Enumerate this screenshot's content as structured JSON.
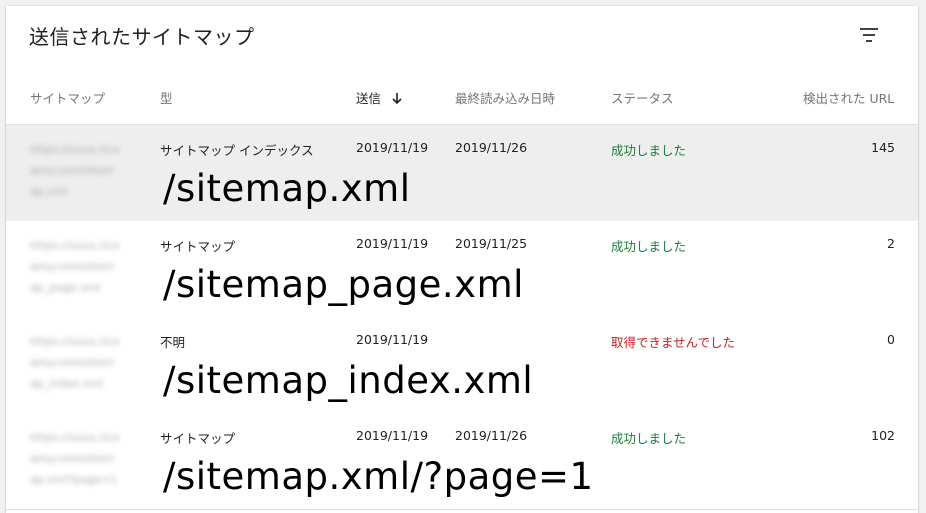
{
  "panel": {
    "title": "送信されたサイトマップ"
  },
  "columns": {
    "sitemap": "サイトマップ",
    "type": "型",
    "submitted": "送信",
    "last_read": "最終読み込み日時",
    "status": "ステータス",
    "discovered_urls": "検出された URL"
  },
  "rows": [
    {
      "sitemap_url": [
        "https://xxxx.rico",
        "amy.com/sitem",
        "ap.xml"
      ],
      "type": "サイトマップ インデックス",
      "submitted": "2019/11/19",
      "last_read": "2019/11/26",
      "status": "成功しました",
      "status_kind": "ok",
      "count": "145",
      "overlay_path": "/sitemap.xml"
    },
    {
      "sitemap_url": [
        "https://xxxx.rico",
        "amy.com/sitem",
        "ap_page.xml"
      ],
      "type": "サイトマップ",
      "submitted": "2019/11/19",
      "last_read": "2019/11/25",
      "status": "成功しました",
      "status_kind": "ok",
      "count": "2",
      "overlay_path": "/sitemap_page.xml"
    },
    {
      "sitemap_url": [
        "https://xxxx.rico",
        "amy.com/sitem",
        "ap_index.xml"
      ],
      "type": "不明",
      "submitted": "2019/11/19",
      "last_read": "",
      "status": "取得できませんでした",
      "status_kind": "error",
      "count": "0",
      "overlay_path": "/sitemap_index.xml"
    },
    {
      "sitemap_url": [
        "https://xxxx.rico",
        "amy.com/sitem",
        "ap.xml?page=1"
      ],
      "type": "サイトマップ",
      "submitted": "2019/11/19",
      "last_read": "2019/11/26",
      "status": "成功しました",
      "status_kind": "ok",
      "count": "102",
      "overlay_path": "/sitemap.xml/?page=1"
    }
  ],
  "colors": {
    "status_ok": "#188038",
    "status_error": "#c5221f",
    "highlight_row": "#eeeeee"
  },
  "icons": {
    "filter": "filter-icon",
    "sort": "arrow-down-icon"
  }
}
